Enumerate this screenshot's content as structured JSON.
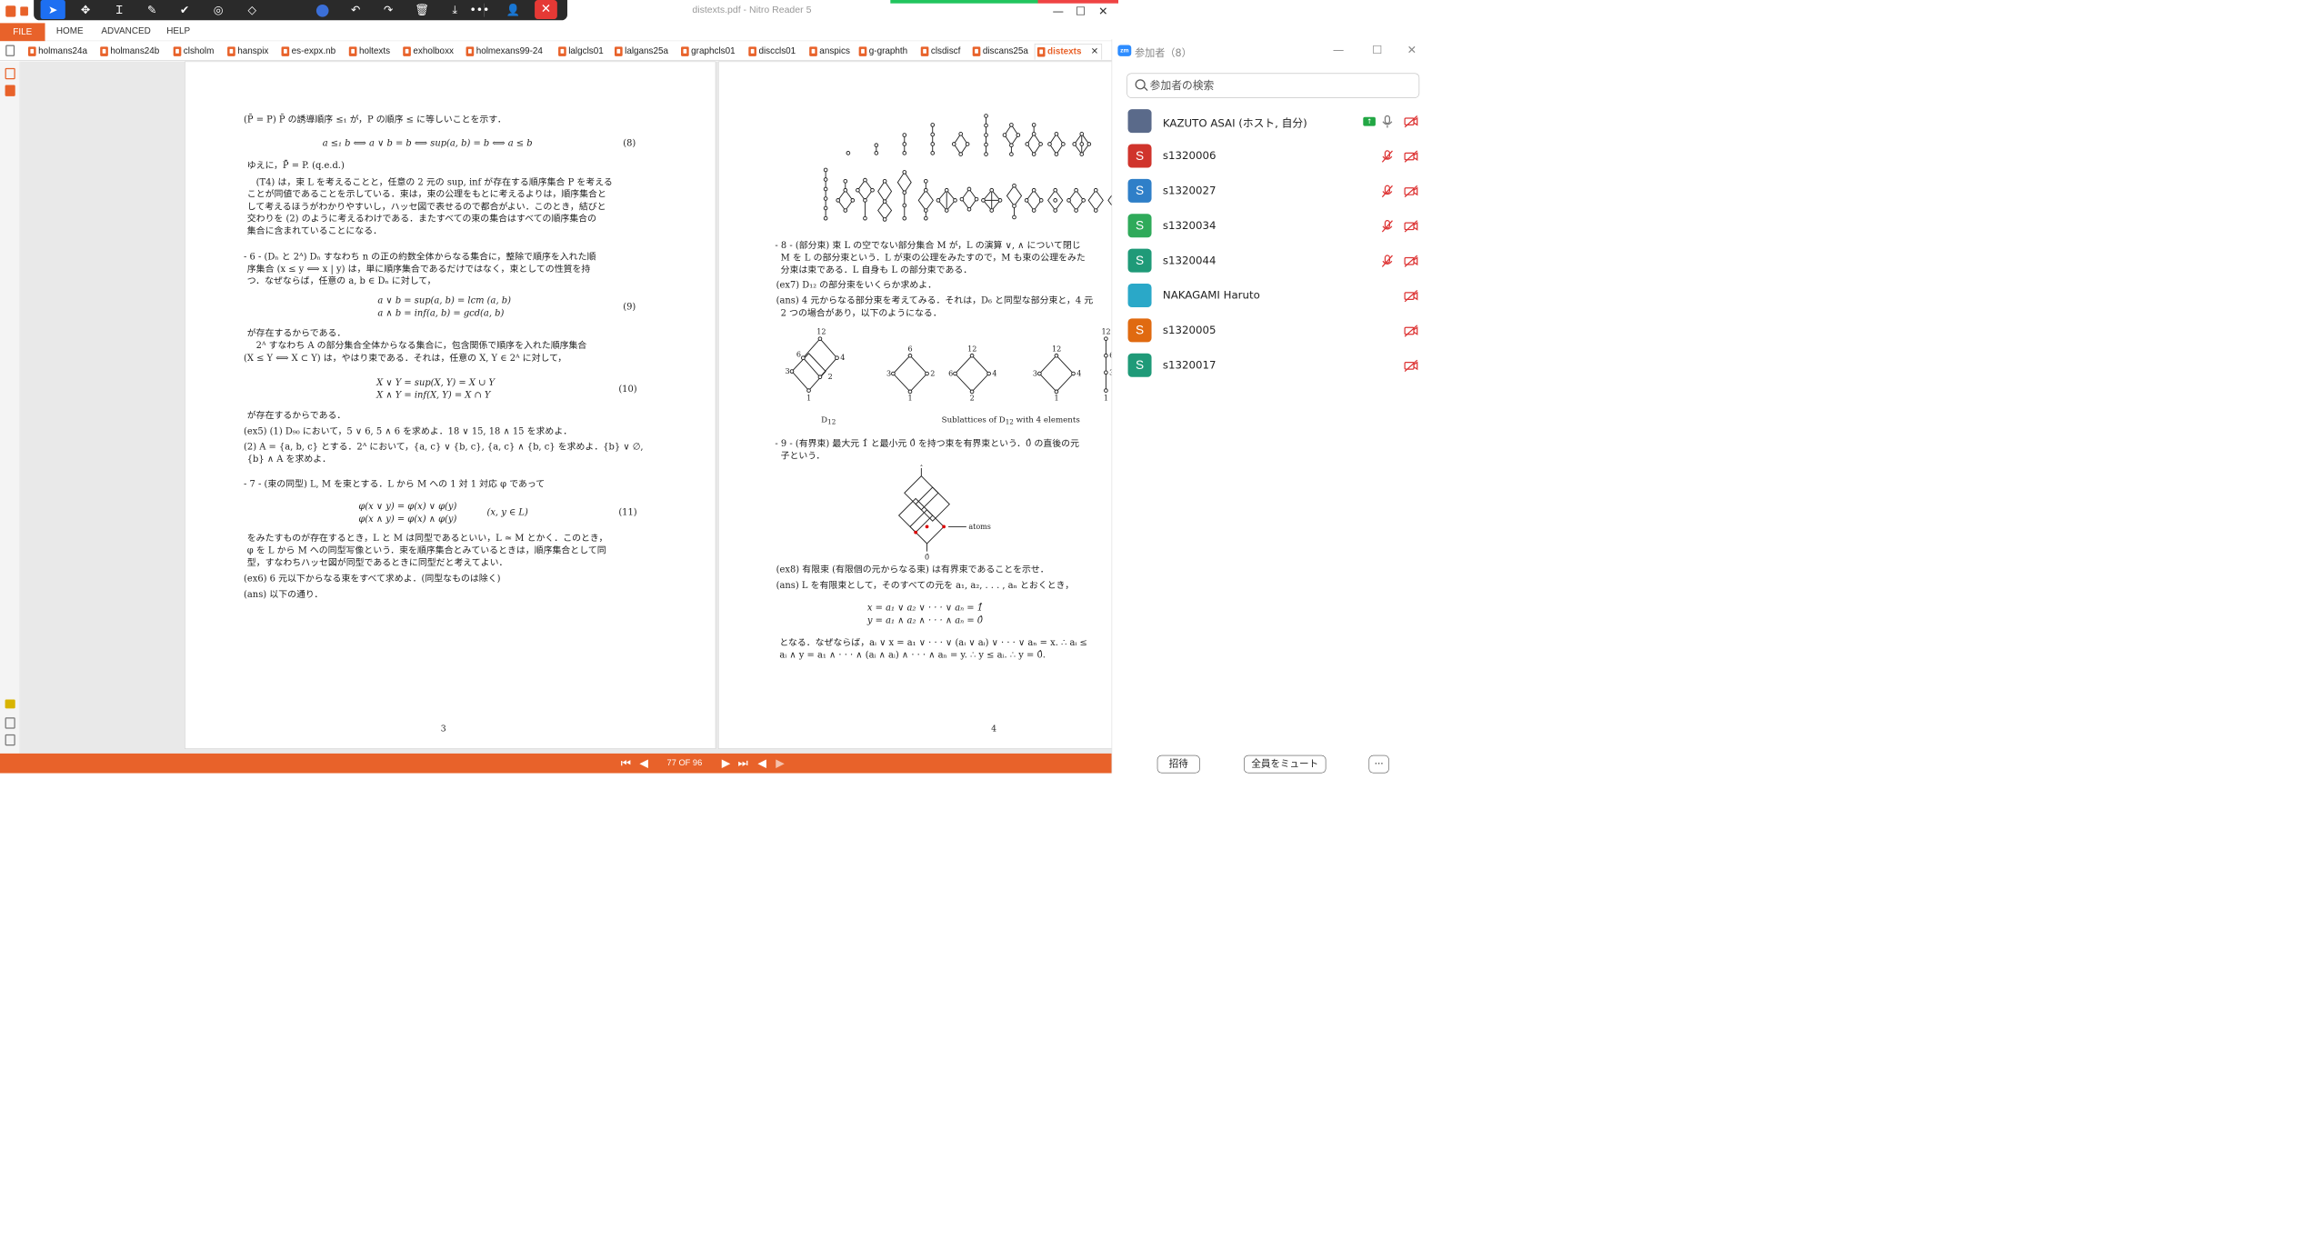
{
  "window": {
    "title": "distexts.pdf - Nitro Reader 5",
    "controls": {
      "minimize": "—",
      "maximize": "☐",
      "close": "✕"
    }
  },
  "annotation_toolbar": {
    "tools": [
      "select-icon",
      "move-icon",
      "text-cursor-icon",
      "pen-icon",
      "check-icon",
      "stamp-icon",
      "eraser-icon",
      "color-icon",
      "undo-icon",
      "redo-icon",
      "delete-icon",
      "download-icon",
      "more-icon",
      "user-icon",
      "close-icon"
    ]
  },
  "menubar": {
    "file": "FILE",
    "home": "HOME",
    "advanced": "ADVANCED",
    "help": "HELP"
  },
  "tabs": [
    "holmans24a",
    "holmans24b",
    "clsholm",
    "hanspix",
    "es-expx.nb",
    "holtexts",
    "exholboxx",
    "holmexans99-24",
    "lalgcls01",
    "lalgans25a",
    "graphcls01",
    "disccls01",
    "anspics",
    "g-graphth",
    "clsdiscf",
    "discans25a"
  ],
  "active_tab": {
    "label": "distexts",
    "close": "✕"
  },
  "page_left": {
    "number": "3",
    "lines": [
      "(P̄ = P)  P̄ の誘導順序 ≤₁ が，P の順序 ≤ に等しいことを示す．",
      "ゆえに，P̄̄ = P.   (q.e.d.)",
      "　(T4) は，束 L を考えることと，任意の 2 元の sup, inf が存在する順序集合 P を考える",
      "ことが同値であることを示している．束は，束の公理をもとに考えるよりは，順序集合と",
      "して考えるほうがわかりやすいし，ハッセ図で表せるので都合がよい．このとき，結びと",
      "交わりを (2) のように考えるわけである．またすべての束の集合はすべての順序集合の",
      "集合に含まれていることになる．",
      "- 6 - (Dₙ と 2ᴬ)  Dₙ すなわち n の正の約数全体からなる集合に，整除で順序を入れた順",
      "序集合 (x ≤ y ⟺ x | y) は，単に順序集合であるだけではなく，束としての性質を持",
      "つ．なぜならば，任意の a, b ∈ Dₙ に対して，",
      "が存在するからである．",
      "　2ᴬ すなわち A の部分集合全体からなる集合に，包含関係で順序を入れた順序集合",
      "(X ≤ Y ⟺ X ⊂ Y) は，やはり束である．それは，任意の X, Y ∈ 2ᴬ に対して，",
      "が存在するからである．",
      "(ex5)  (1) D₉₀ において，5 ∨ 6, 5 ∧ 6 を求めよ．18 ∨ 15, 18 ∧ 15 を求めよ．",
      "(2) A = {a, b, c} とする．2ᴬ において，{a, c} ∨ {b, c}, {a, c} ∧ {b, c} を求めよ．{b} ∨ ∅,",
      "{b} ∧ A を求めよ．",
      "- 7 - (束の同型)  L, M を束とする．L から M への 1 対 1 対応 φ であって",
      "をみたすものが存在するとき，L と M は同型であるといい，L ≃ M とかく．このとき，",
      "φ を L から M への同型写像という．束を順序集合とみているときは，順序集合として同",
      "型，すなわちハッセ図が同型であるときに同型だと考えてよい．",
      "(ex6)  6 元以下からなる束をすべて求めよ．(同型なものは除く)",
      "(ans)  以下の通り．"
    ],
    "equations": {
      "eq8": "a ≤₁ b  ⟺  a ∨ b = b  ⟺  sup(a, b) = b  ⟺  a ≤ b",
      "eq8_num": "(8)",
      "eq9a": "a ∨ b = sup(a, b) = lcm (a, b)",
      "eq9b": "a ∧ b = inf(a, b) = gcd(a, b)",
      "eq9_num": "(9)",
      "eq10a": "X ∨ Y = sup(X, Y) = X ∪ Y",
      "eq10b": "X ∧ Y = inf(X, Y) = X ∩ Y",
      "eq10_num": "(10)",
      "eq11a": "φ(x ∨ y) = φ(x) ∨ φ(y)",
      "eq11b": "φ(x ∧ y) = φ(x) ∧ φ(y)",
      "eq11c": "(x, y ∈ L)",
      "eq11_num": "(11)"
    }
  },
  "page_right": {
    "number": "4",
    "lines": [
      "- 8 - (部分束)  束 L の空でない部分集合 M が，L の演算 ∨, ∧ について閉じ",
      "M を L の部分束という．L が束の公理をみたすので，M も束の公理をみた",
      "分束は束である．L 自身も L の部分束である．",
      "(ex7)  D₁₂ の部分束をいくらか求めよ．",
      "(ans)  4 元からなる部分束を考えてみる．それは，D₆ と同型な部分束と，4 元",
      "2 つの場合があり，以下のようになる．",
      "- 9 - (有界束)  最大元 1̂ と最小元 0̂ を持つ束を有界束という．0̂ の直後の元",
      "子という．",
      "(ex8)  有限束 (有限個の元からなる束) は有界束であることを示せ．",
      "(ans)  L を有限束として，そのすべての元を a₁, a₂, . . . , aₙ とおくとき，",
      "となる．なぜならば，aᵢ ∨ x = a₁ ∨ · · · ∨ (aᵢ ∨ aᵢ) ∨ · · · ∨ aₙ = x.  ∴  aᵢ ≤",
      "aᵢ ∧ y = a₁ ∧ · · · ∧ (aᵢ ∧ aᵢ) ∧ · · · ∧ aₙ = y.  ∴  y ≤ aᵢ.  ∴  y = 0̂."
    ],
    "equations": {
      "eqA": "x = a₁ ∨ a₂ ∨ · · · ∨ aₙ = 1̂",
      "eqB": "y = a₁ ∧ a₂ ∧ · · · ∧ aₙ = 0̂"
    },
    "figure_labels": {
      "d12": "D",
      "d12_sub": "12",
      "sublattices": "Sublattices of D",
      "sublattices_sub": "12",
      "sublattices_tail": "with 4 elements",
      "atoms": "atoms",
      "one_hat": "1̂",
      "zero_hat": "0̂"
    },
    "hasse_nodes": {
      "d12": [
        "12",
        "6",
        "4",
        "3",
        "2",
        "1"
      ],
      "sub1": [
        "6",
        "3",
        "2",
        "1"
      ],
      "sub2": [
        "12",
        "6",
        "4",
        "2"
      ],
      "sub3": [
        "12",
        "3",
        "4",
        "1"
      ],
      "sub4": [
        "12",
        "6",
        "3",
        "1"
      ]
    }
  },
  "navigation": {
    "page_indicator": "77 OF 96",
    "first": "⏮",
    "prev": "◀",
    "next": "▶",
    "last": "⏭",
    "back": "◀",
    "forward": "▶"
  },
  "zoom_panel": {
    "logo": "zm",
    "title": "参加者（8）",
    "search_placeholder": "参加者の検索",
    "participants": [
      {
        "name": "KAZUTO ASAI (ホスト, 自分)",
        "initial": "",
        "color": "#5a6a8a",
        "sharing": true
      },
      {
        "name": "s1320006",
        "initial": "S",
        "color": "#d0342c"
      },
      {
        "name": "s1320027",
        "initial": "S",
        "color": "#2f7fc8"
      },
      {
        "name": "s1320034",
        "initial": "S",
        "color": "#2faa5a"
      },
      {
        "name": "s1320044",
        "initial": "S",
        "color": "#1f9a78"
      },
      {
        "name": "NAKAGAMI Haruto",
        "initial": "",
        "color": "#2aa8c8"
      },
      {
        "name": "s1320005",
        "initial": "S",
        "color": "#e06a10"
      },
      {
        "name": "s1320017",
        "initial": "S",
        "color": "#1f9a78"
      }
    ],
    "invite_button": "招待",
    "mute_all_button": "全員をミュート",
    "more_button": "···"
  }
}
